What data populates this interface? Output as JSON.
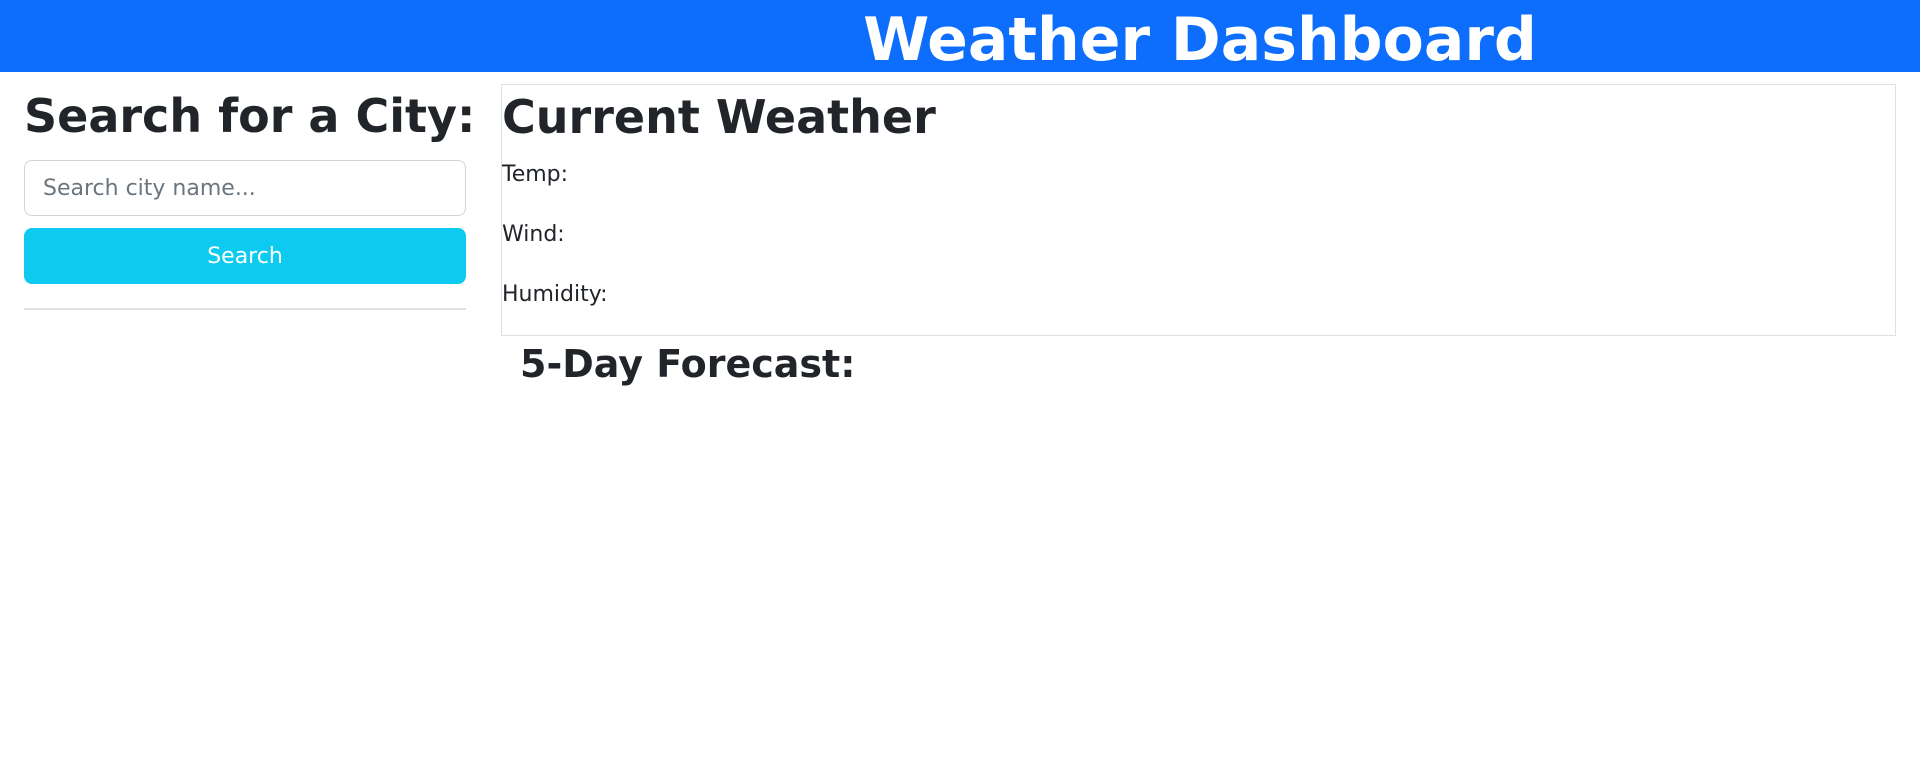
{
  "header": {
    "title": "Weather Dashboard",
    "background_color": "#0d6efd"
  },
  "sidebar": {
    "heading": "Search for a City:",
    "search": {
      "placeholder": "Search city name...",
      "value": ""
    },
    "search_button_label": "Search",
    "search_button_color": "#0dcaf0"
  },
  "current_weather": {
    "heading": "Current Weather",
    "temp_label": "Temp:",
    "wind_label": "Wind:",
    "humidity_label": "Humidity:"
  },
  "forecast": {
    "heading": "5-Day Forecast:"
  }
}
